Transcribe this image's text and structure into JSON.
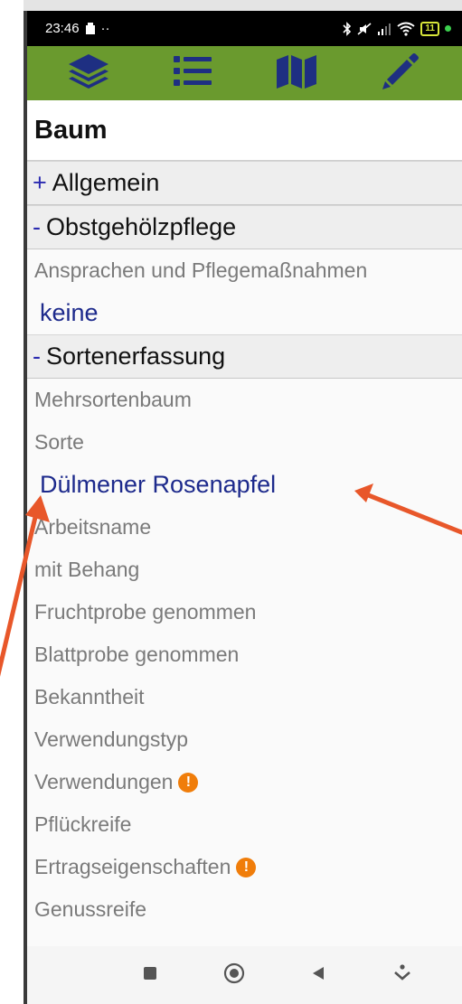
{
  "status_bar": {
    "time": "23:46",
    "extra": "··",
    "battery": "11"
  },
  "toolbar": {
    "icons": [
      "layers-icon",
      "list-icon",
      "map-icon",
      "pencil-icon"
    ],
    "color": "#6a9a2e"
  },
  "page": {
    "title": "Baum"
  },
  "sections": {
    "allgemein": {
      "sign": "+",
      "label": "Allgemein"
    },
    "obst": {
      "sign": "-",
      "label": "Obstgehölzpflege"
    },
    "sorten": {
      "sign": "-",
      "label": "Sortenerfassung"
    }
  },
  "fields": {
    "ansprachen": {
      "label": "Ansprachen und Pflegemaßnahmen",
      "value": "keine"
    },
    "mehrsortenbaum": {
      "label": "Mehrsortenbaum"
    },
    "sorte": {
      "label": "Sorte",
      "value": "Dülmener Rosenapfel"
    },
    "arbeitsname": {
      "label": "Arbeitsname"
    },
    "behang": {
      "label": "mit Behang"
    },
    "fruchtprobe": {
      "label": "Fruchtprobe genommen"
    },
    "blattprobe": {
      "label": "Blattprobe genommen"
    },
    "bekanntheit": {
      "label": "Bekanntheit"
    },
    "verwendungstyp": {
      "label": "Verwendungstyp"
    },
    "verwendungen": {
      "label": "Verwendungen",
      "warning": "!"
    },
    "pflueckreife": {
      "label": "Pflückreife"
    },
    "ertrag": {
      "label": "Ertragseigenschaften",
      "warning": "!"
    },
    "genussreife": {
      "label": "Genussreife"
    }
  },
  "colors": {
    "accent": "#6a9a2e",
    "value_text": "#1d2a8c",
    "warning": "#f07d0a",
    "annotation_arrow": "#e8572a"
  }
}
